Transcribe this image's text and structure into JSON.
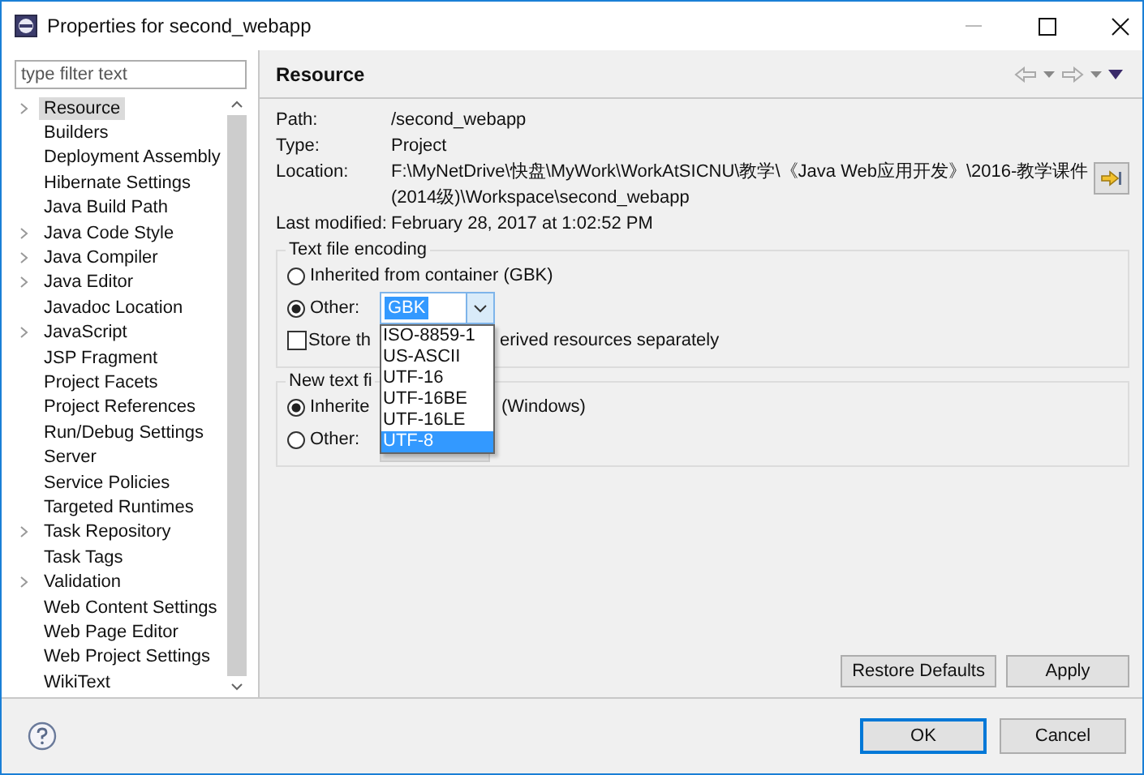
{
  "window": {
    "title": "Properties for second_webapp"
  },
  "sidebar": {
    "filter": {
      "placeholder": "type filter text"
    },
    "items": [
      {
        "label": "Resource",
        "expandable": true,
        "selected": true
      },
      {
        "label": "Builders",
        "expandable": false,
        "selected": false
      },
      {
        "label": "Deployment Assembly",
        "expandable": false,
        "selected": false
      },
      {
        "label": "Hibernate Settings",
        "expandable": false,
        "selected": false
      },
      {
        "label": "Java Build Path",
        "expandable": false,
        "selected": false
      },
      {
        "label": "Java Code Style",
        "expandable": true,
        "selected": false
      },
      {
        "label": "Java Compiler",
        "expandable": true,
        "selected": false
      },
      {
        "label": "Java Editor",
        "expandable": true,
        "selected": false
      },
      {
        "label": "Javadoc Location",
        "expandable": false,
        "selected": false
      },
      {
        "label": "JavaScript",
        "expandable": true,
        "selected": false
      },
      {
        "label": "JSP Fragment",
        "expandable": false,
        "selected": false
      },
      {
        "label": "Project Facets",
        "expandable": false,
        "selected": false
      },
      {
        "label": "Project References",
        "expandable": false,
        "selected": false
      },
      {
        "label": "Run/Debug Settings",
        "expandable": false,
        "selected": false
      },
      {
        "label": "Server",
        "expandable": false,
        "selected": false
      },
      {
        "label": "Service Policies",
        "expandable": false,
        "selected": false
      },
      {
        "label": "Targeted Runtimes",
        "expandable": false,
        "selected": false
      },
      {
        "label": "Task Repository",
        "expandable": true,
        "selected": false
      },
      {
        "label": "Task Tags",
        "expandable": false,
        "selected": false
      },
      {
        "label": "Validation",
        "expandable": true,
        "selected": false
      },
      {
        "label": "Web Content Settings",
        "expandable": false,
        "selected": false
      },
      {
        "label": "Web Page Editor",
        "expandable": false,
        "selected": false
      },
      {
        "label": "Web Project Settings",
        "expandable": false,
        "selected": false
      },
      {
        "label": "WikiText",
        "expandable": false,
        "selected": false
      }
    ]
  },
  "page": {
    "title": "Resource"
  },
  "properties": [
    {
      "label": "Path:",
      "lines": [
        "/second_webapp"
      ]
    },
    {
      "label": "Type:",
      "lines": [
        "Project"
      ]
    },
    {
      "label": "Location:",
      "lines": [
        "F:\\MyNetDrive\\快盘\\MyWork\\WorkAtSICNU\\教学\\《Java Web应用开发》\\2016-教学课件",
        "(2014级)\\Workspace\\second_webapp"
      ]
    },
    {
      "label": "Last modified:",
      "lines": [
        "February 28, 2017 at 1:02:52 PM"
      ]
    }
  ],
  "encoding": {
    "title": "Text file encoding",
    "inherited": {
      "label": "Inherited from container (GBK)",
      "selected": false
    },
    "other": {
      "label": "Other:",
      "selected": true,
      "value": "GBK",
      "options": [
        {
          "label": "ISO-8859-1",
          "selected": false
        },
        {
          "label": "US-ASCII",
          "selected": false
        },
        {
          "label": "UTF-16",
          "selected": false
        },
        {
          "label": "UTF-16BE",
          "selected": false
        },
        {
          "label": "UTF-16LE",
          "selected": false
        },
        {
          "label": "UTF-8",
          "selected": true
        }
      ]
    },
    "store": {
      "checked": false,
      "label_start": "Store th",
      "label_end": "erived resources separately"
    }
  },
  "line_delimiter": {
    "title": "New text fi",
    "inherited": {
      "label_start": "Inherite",
      "label_end": "(Windows)",
      "selected": true
    },
    "other": {
      "label": "Other:",
      "selected": false
    }
  },
  "buttons": {
    "restore": "Restore Defaults",
    "apply": "Apply",
    "ok": "OK",
    "cancel": "Cancel"
  }
}
